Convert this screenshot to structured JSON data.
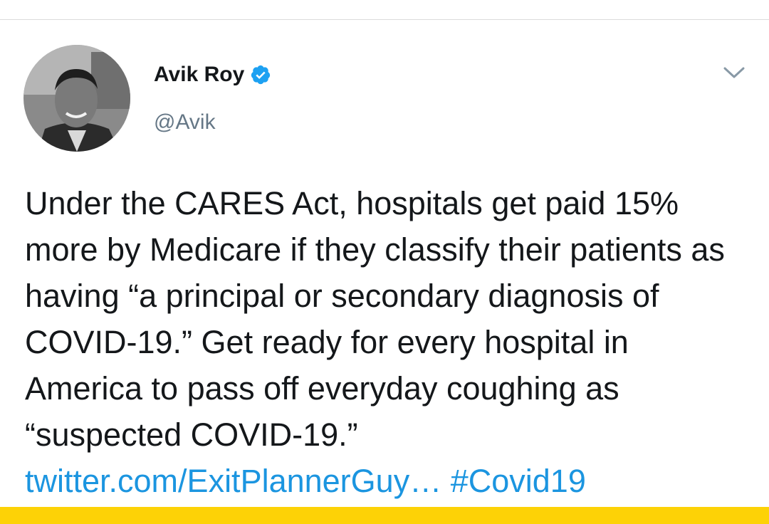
{
  "tweet": {
    "author": {
      "display_name": "Avik Roy",
      "handle": "@Avik",
      "verified": true
    },
    "text": "Under the CARES Act, hospitals get paid 15% more by Medicare if they classify their patients as having “a principal or secondary diagnosis of COVID-19.” Get ready for every hospital in America to pass off everyday coughing as “suspected COVID-19.”",
    "link": "twitter.com/ExitPlannerGuy…",
    "hashtag": "#Covid19"
  },
  "colors": {
    "link": "#1b95e0",
    "verified_badge": "#1da1f2",
    "bottom_bar": "#fdd206"
  },
  "icons": {
    "verified": "verified-badge-icon",
    "menu": "chevron-down-icon"
  }
}
